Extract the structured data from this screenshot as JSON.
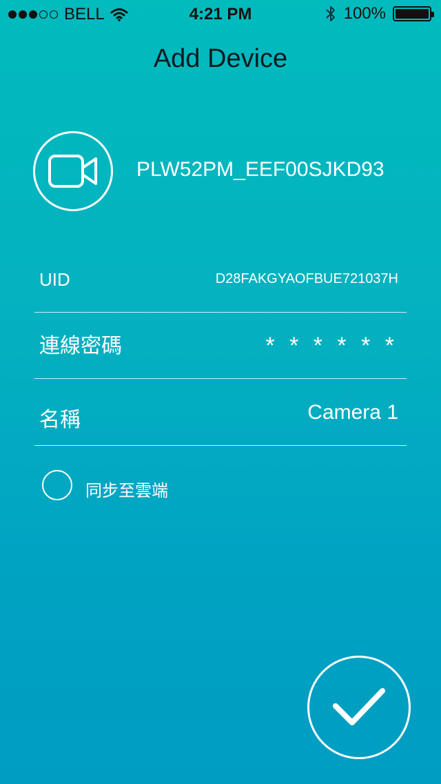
{
  "status_bar": {
    "carrier": "BELL",
    "time": "4:21 PM",
    "battery_percent": "100%",
    "signal_bars_filled": 3,
    "signal_bars_total": 5,
    "battery_level": 1.0
  },
  "header": {
    "title": "Add Device"
  },
  "device": {
    "name": "PLW52PM_EEF00SJKD93",
    "icon": "video-camera-icon"
  },
  "fields": {
    "uid": {
      "label": "UID",
      "value": "D28FAKGYAOFBUE721037H"
    },
    "password": {
      "label": "連線密碼",
      "value": "* * * * * *"
    },
    "name": {
      "label": "名稱",
      "value": "Camera 1"
    }
  },
  "sync": {
    "label": "同步至雲端",
    "checked": false
  },
  "confirm": {
    "icon": "checkmark-icon"
  }
}
